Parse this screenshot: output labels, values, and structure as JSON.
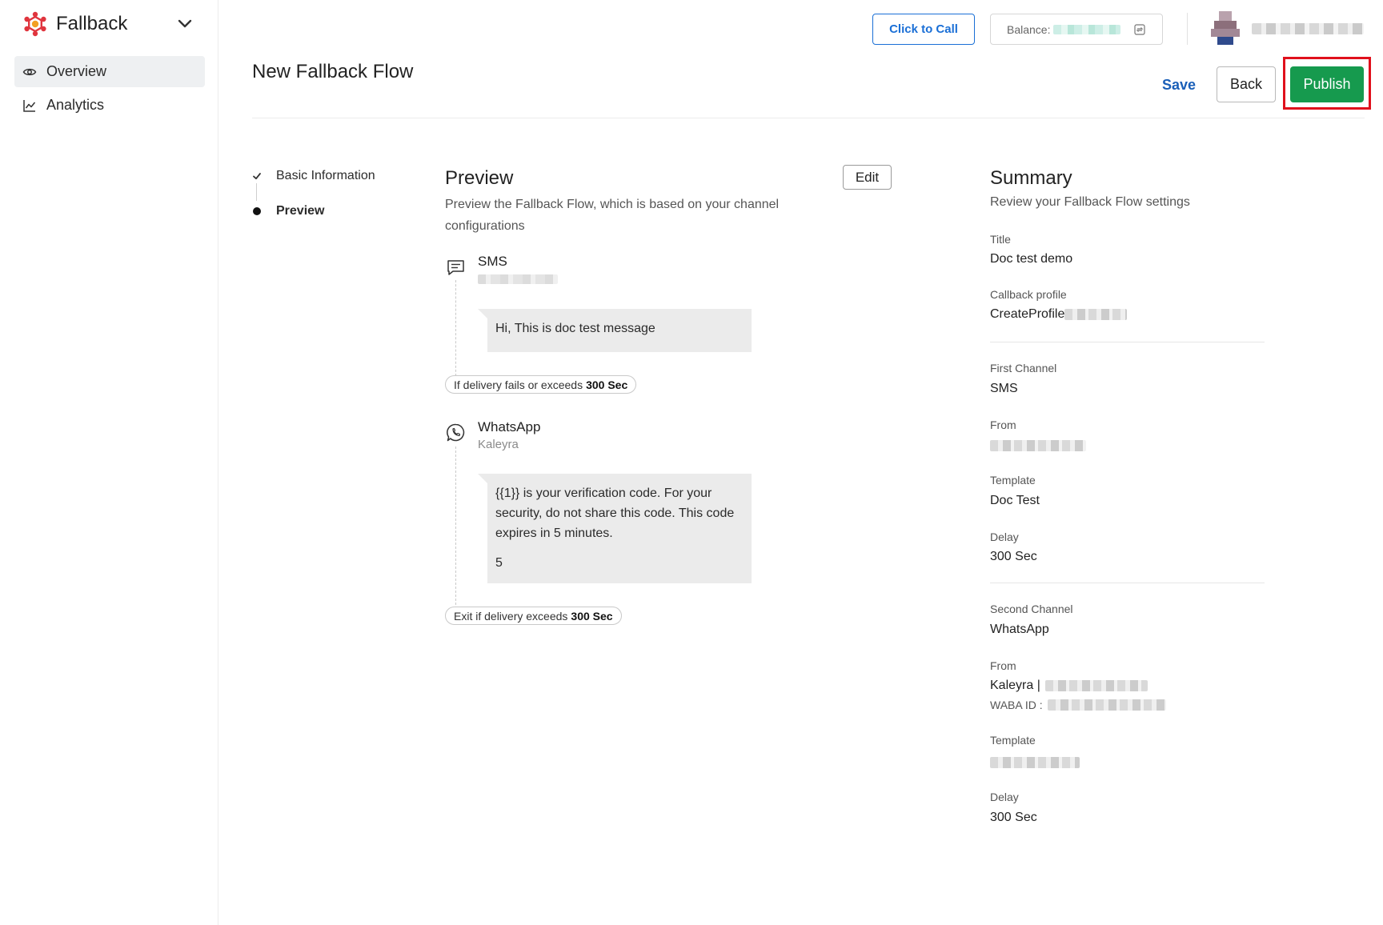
{
  "app": {
    "name": "Fallback"
  },
  "sidebar": {
    "items": [
      {
        "label": "Overview",
        "icon": "eye-icon",
        "active": true
      },
      {
        "label": "Analytics",
        "icon": "line-chart-icon",
        "active": false
      }
    ]
  },
  "topbar": {
    "call_label": "Click to Call",
    "balance_label": "Balance:"
  },
  "header": {
    "title": "New Fallback Flow",
    "save_label": "Save",
    "back_label": "Back",
    "publish_label": "Publish"
  },
  "steps": [
    {
      "label": "Basic Information",
      "state": "done"
    },
    {
      "label": "Preview",
      "state": "current"
    }
  ],
  "preview": {
    "title": "Preview",
    "subtitle": "Preview the Fallback Flow, which is based on your channel configurations",
    "edit_label": "Edit",
    "channels": [
      {
        "name": "SMS",
        "icon": "message-icon",
        "message": "Hi, This is doc test message"
      },
      {
        "name": "WhatsApp",
        "icon": "whatsapp-icon",
        "sender": "Kaleyra",
        "message": "{{1}} is your verification code. For your security, do not share this code. This code expires in 5 minutes.",
        "footer": "5"
      }
    ],
    "rule1": {
      "text": "If delivery fails or exceeds",
      "value": "300 Sec"
    },
    "rule2": {
      "text": "Exit if delivery exceeds",
      "value": "300 Sec"
    }
  },
  "summary": {
    "title": "Summary",
    "subtitle": "Review your Fallback Flow settings",
    "title_label": "Title",
    "title_value": "Doc test demo",
    "callback_label": "Callback profile",
    "callback_value": "CreateProfile",
    "first_channel_label": "First Channel",
    "first_channel_value": "SMS",
    "from_label": "From",
    "template_label": "Template",
    "first_template_value": "Doc Test",
    "delay_label": "Delay",
    "first_delay_value": "300 Sec",
    "second_channel_label": "Second Channel",
    "second_channel_value": "WhatsApp",
    "second_from_value": "Kaleyra |",
    "waba_label": "WABA ID :",
    "second_delay_value": "300 Sec"
  },
  "colors": {
    "primary_blue": "#1a6fd6",
    "publish_green": "#169a4e",
    "highlight_red": "#e0101c",
    "logo_red": "#e0353e"
  }
}
